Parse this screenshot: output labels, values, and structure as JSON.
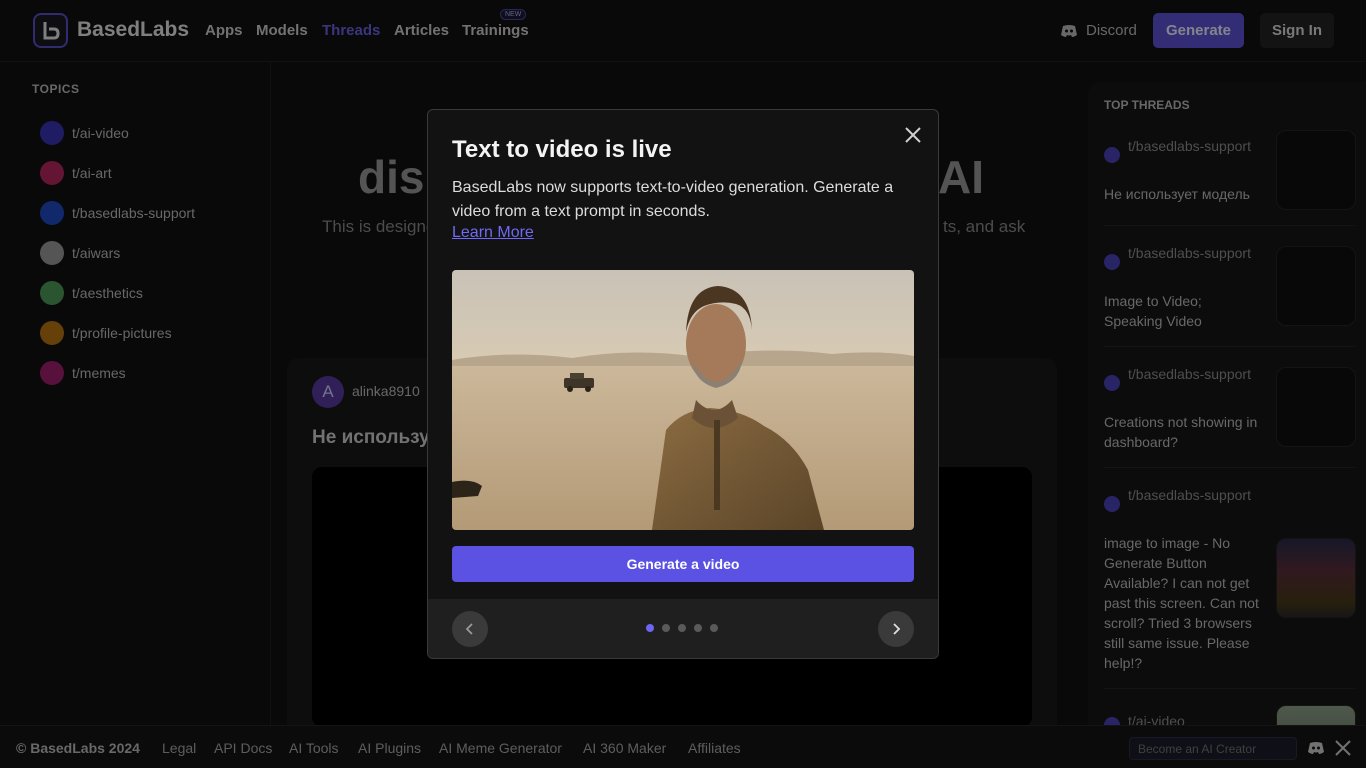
{
  "header": {
    "brand": "BasedLabs",
    "nav": [
      "Apps",
      "Models",
      "Threads",
      "Articles",
      "Trainings"
    ],
    "new_badge": "NEW",
    "discord": "Discord",
    "generate": "Generate",
    "sign_in": "Sign In"
  },
  "sidebar": {
    "title": "TOPICS",
    "topics": [
      {
        "label": "t/ai-video",
        "color": "#3b33b5"
      },
      {
        "label": "t/ai-art",
        "color": "#b8275f"
      },
      {
        "label": "t/basedlabs-support",
        "color": "#1f49c4"
      },
      {
        "label": "t/aiwars",
        "color": "#9c9c9c"
      },
      {
        "label": "t/aesthetics",
        "color": "#4f9b5a"
      },
      {
        "label": "t/profile-pictures",
        "color": "#b8760f"
      },
      {
        "label": "t/memes",
        "color": "#a0206f"
      }
    ]
  },
  "main": {
    "hero_left": "dis",
    "hero_right": "AI",
    "desc_left": "This is designe",
    "desc_right": "ts, and ask",
    "post": {
      "avatar": "A",
      "user": "alinka8910",
      "title": "Не использует модель"
    }
  },
  "right": {
    "title": "TOP THREADS",
    "threads": [
      {
        "topic": "t/basedlabs-support",
        "title": "Не использует модель"
      },
      {
        "topic": "t/basedlabs-support",
        "title": "Image to Video; Speaking Video"
      },
      {
        "topic": "t/basedlabs-support",
        "title": "Creations not showing in dashboard?"
      },
      {
        "topic": "t/basedlabs-support",
        "title": "image to image - No Generate Button Available? I can not get past this screen. Can not scroll? Tried 3 browsers still same issue. Please help!?"
      },
      {
        "topic": "t/ai-video",
        "title": ""
      }
    ]
  },
  "modal": {
    "title": "Text to video is live",
    "description": "BasedLabs now supports text-to-video generation. Generate a video from a text prompt in seconds.",
    "link": "Learn More",
    "cta": "Generate a video",
    "active_slide": 1,
    "slide_count": 5
  },
  "footer": {
    "copyright": "© BasedLabs 2024",
    "links": [
      "Legal",
      "API Docs",
      "AI Tools",
      "AI Plugins",
      "AI Meme Generator",
      "AI 360 Maker",
      "Affiliates"
    ],
    "creator_placeholder": "Become an AI Creator"
  }
}
